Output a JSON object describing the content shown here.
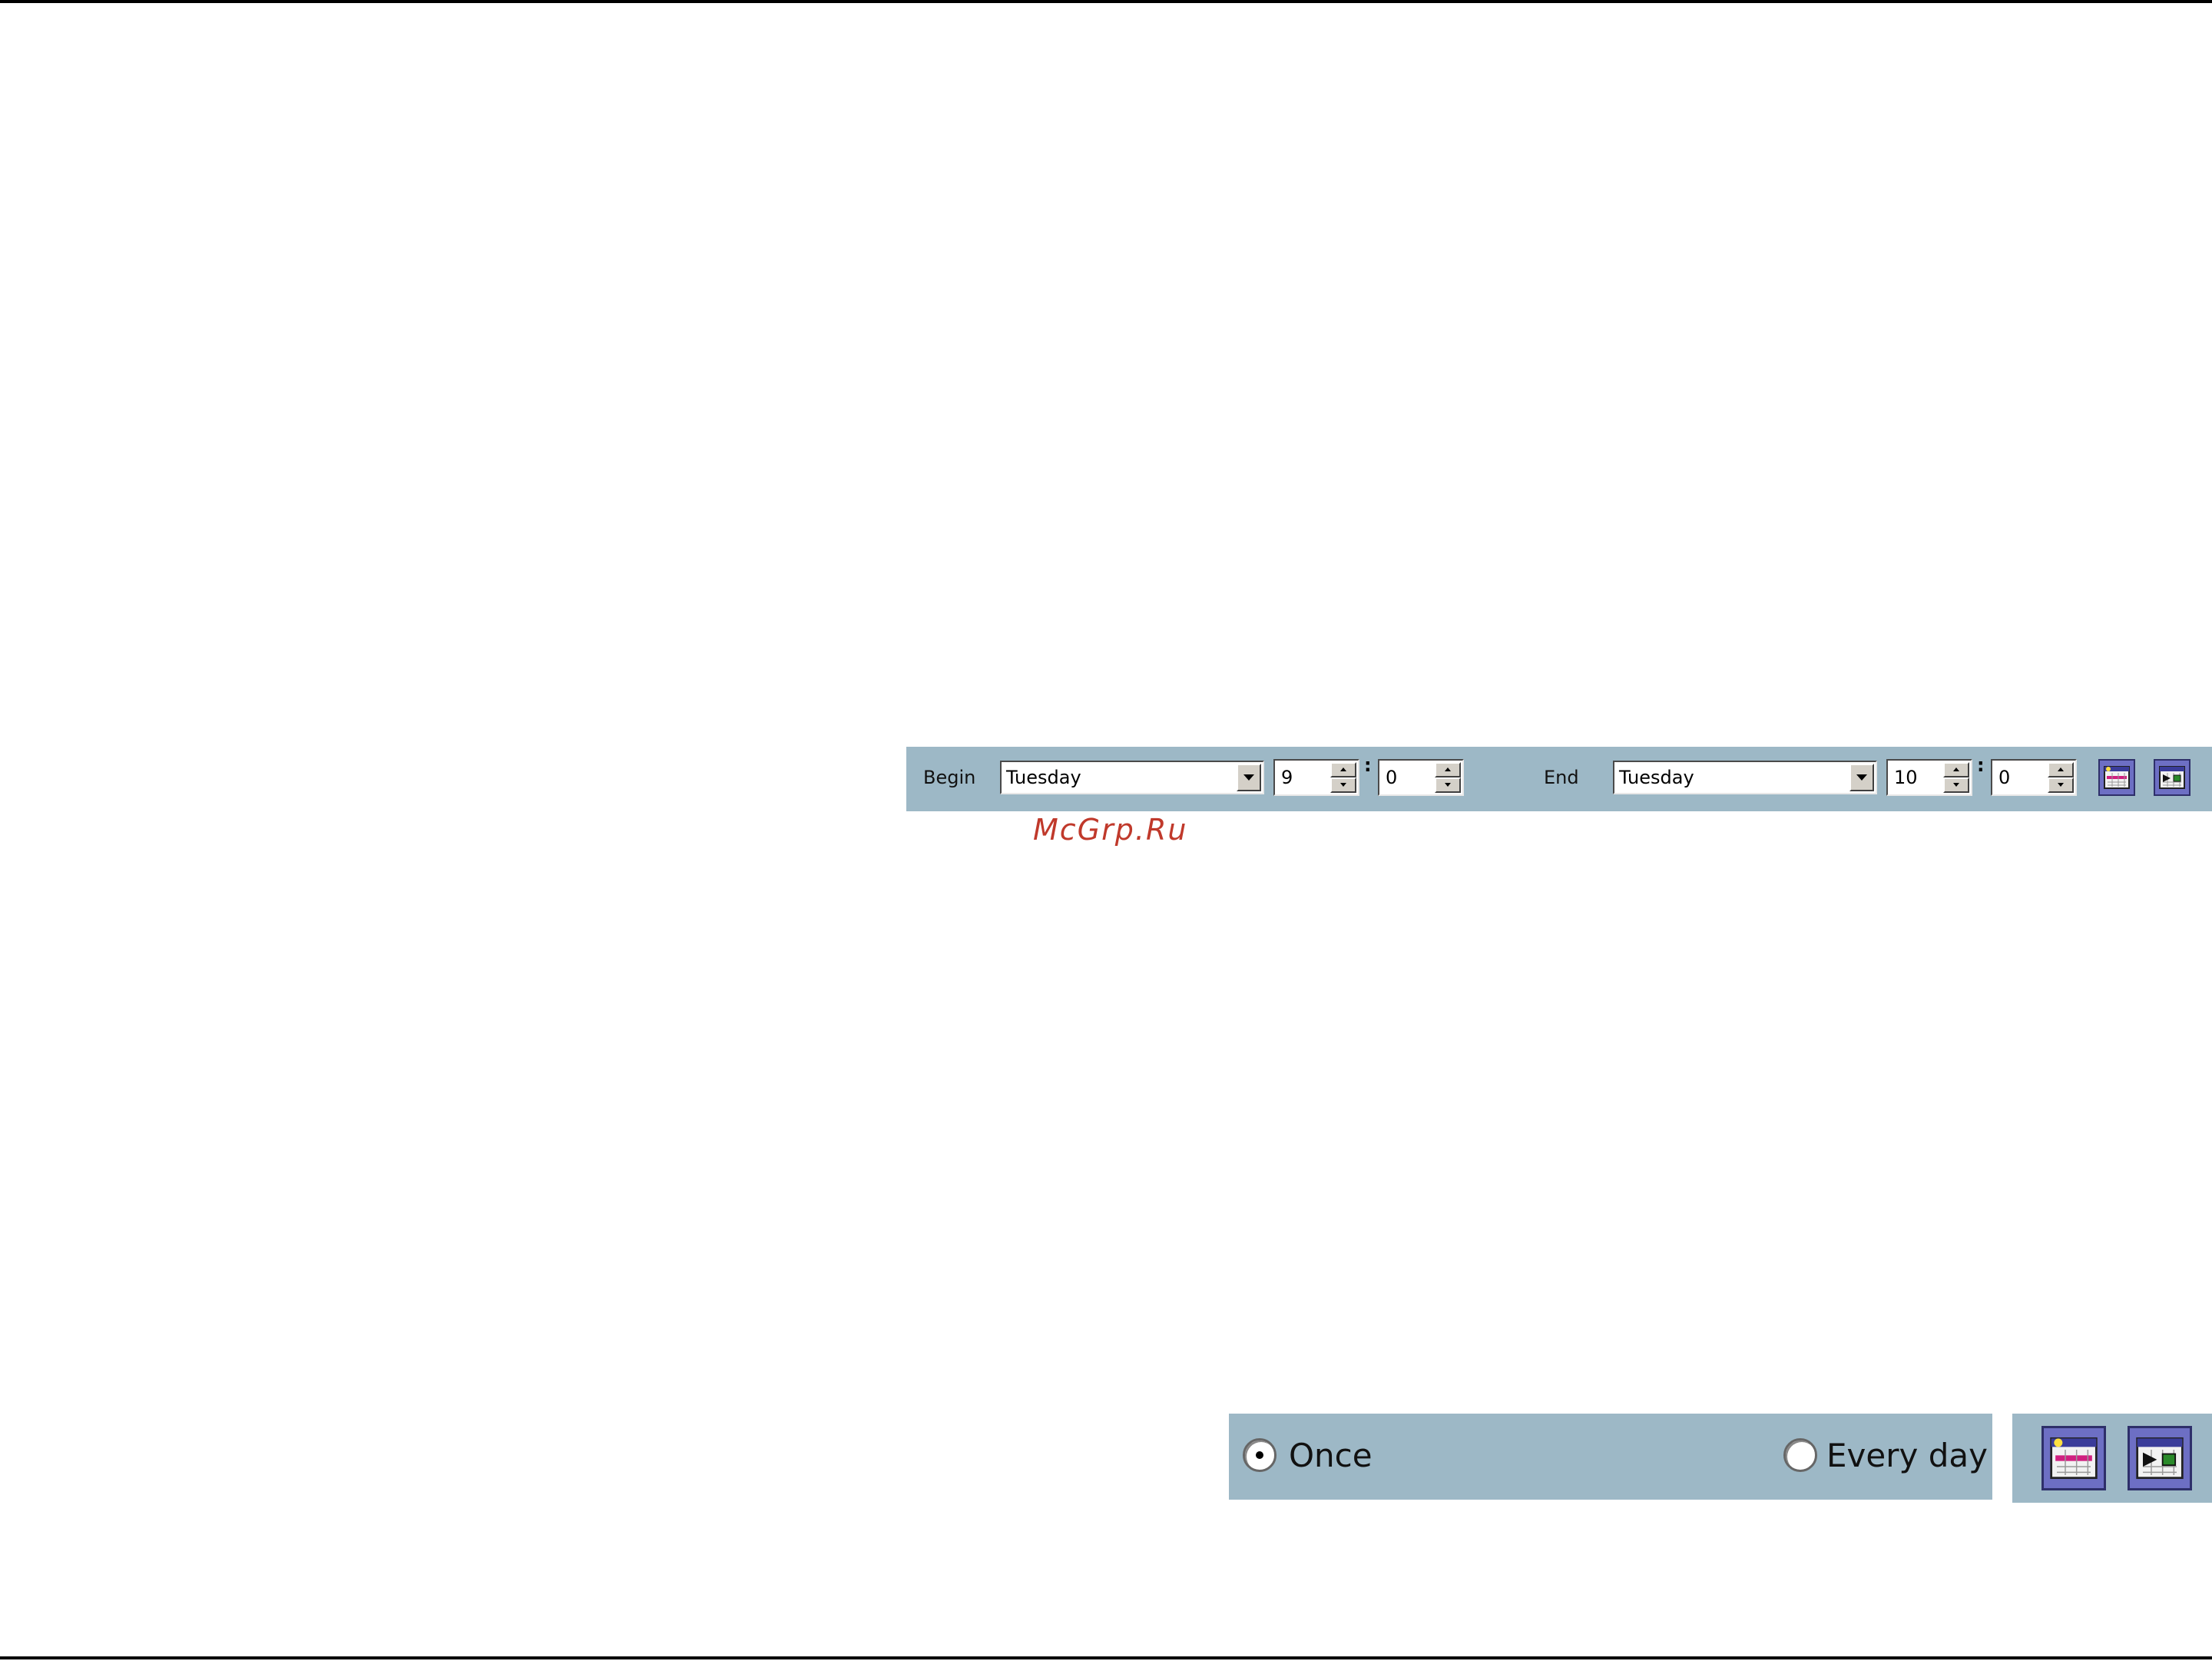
{
  "schedule": {
    "begin_label": "Begin",
    "begin_day": "Tuesday",
    "begin_hour": "9",
    "begin_minute": "0",
    "time_separator": ":",
    "end_label": "End",
    "end_day": "Tuesday",
    "end_hour": "10",
    "end_minute": "0",
    "icons": [
      "calendar-add-icon",
      "calendar-insert-icon"
    ]
  },
  "watermark": "McGrp.Ru",
  "repeat": {
    "options": [
      {
        "label": "Once",
        "selected": true
      },
      {
        "label": "Every day",
        "selected": false
      }
    ],
    "icons": [
      "calendar-add-icon",
      "calendar-insert-icon"
    ]
  },
  "colors": {
    "bar_background": "#9db8c6",
    "icon_background": "#6d6fc4",
    "watermark": "#c0392b"
  }
}
